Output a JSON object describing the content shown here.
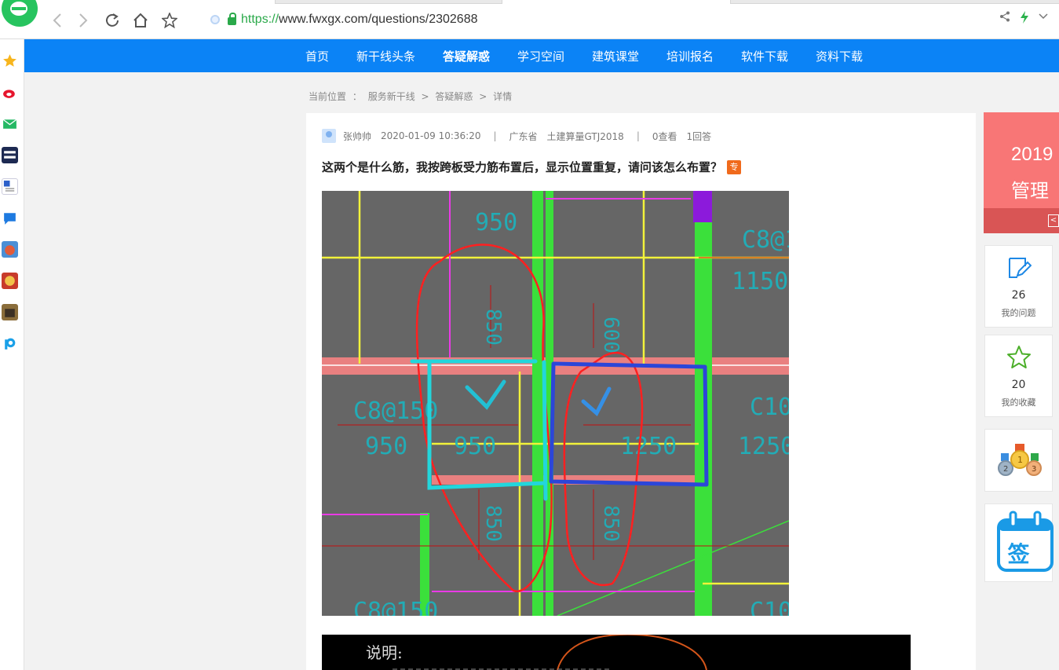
{
  "browser": {
    "url_scheme": "https://",
    "url_rest": "www.fwxgx.com/questions/2302688"
  },
  "nav": {
    "items": [
      "首页",
      "新干线头条",
      "答疑解惑",
      "学习空间",
      "建筑课堂",
      "培训报名",
      "软件下载",
      "资料下载"
    ],
    "active_index": 2
  },
  "breadcrumb": {
    "label": "当前位置",
    "colon": "：",
    "items": [
      "服务新干线",
      ">",
      "答疑解惑",
      ">",
      "详情"
    ]
  },
  "question": {
    "author": "张帅帅",
    "datetime": "2020-01-09 10:36:20",
    "separator": "|",
    "region": "广东省",
    "software": "土建算量GTJ2018",
    "views": "0查看",
    "answers": "1回答",
    "title": "这两个是什么筋，我按跨板受力筋布置后，显示位置重复，请问该怎么布置？",
    "badge": "专"
  },
  "cad_image": {
    "labels": [
      "950",
      "850",
      "C8@1",
      "1150",
      "600",
      "C8@150",
      "950",
      "950",
      "1250",
      "1250",
      "C10",
      "850",
      "850",
      "C8@150",
      "C10"
    ],
    "note_label": "说明:"
  },
  "sidebar": {
    "promo_year": "2019",
    "promo_text": "管理",
    "my_questions_count": "26",
    "my_questions_label": "我的问题",
    "my_favorites_count": "20",
    "my_favorites_label": "我的收藏",
    "signin_label": "签"
  },
  "colors": {
    "nav_blue": "#0b83f6",
    "badge_orange": "#f06a1c",
    "promo_red": "#f87676",
    "link_green": "#2aa94a"
  }
}
